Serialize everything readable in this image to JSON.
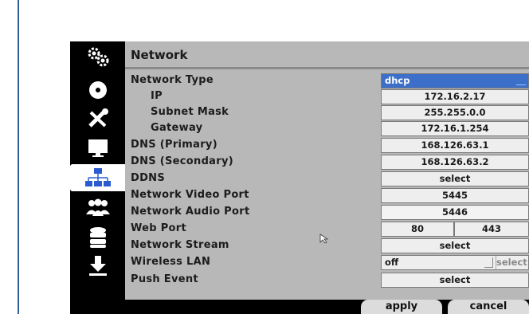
{
  "panel": {
    "title": "Network"
  },
  "rows": [
    {
      "label": "Network Type",
      "value": "dhcp"
    },
    {
      "label": "IP",
      "value": "172.16.2.17"
    },
    {
      "label": "Subnet Mask",
      "value": "255.255.0.0"
    },
    {
      "label": "Gateway",
      "value": "172.16.1.254"
    },
    {
      "label": "DNS (Primary)",
      "value": "168.126.63.1"
    },
    {
      "label": "DNS (Secondary)",
      "value": "168.126.63.2"
    },
    {
      "label": "DDNS",
      "value": "select"
    },
    {
      "label": "Network Video Port",
      "value": "5445"
    },
    {
      "label": "Network Audio Port",
      "value": "5446"
    },
    {
      "label": "Web Port",
      "value_http": "80",
      "value_https": "443"
    },
    {
      "label": "Network Stream",
      "value": "select"
    },
    {
      "label": "Wireless LAN",
      "value": "off",
      "select": "select"
    },
    {
      "label": "Push Event",
      "value": "select"
    }
  ],
  "buttons": {
    "apply": "apply",
    "cancel": "cancel"
  },
  "sidebar": [
    "gears-icon",
    "disc-icon",
    "tools-icon",
    "monitor-icon",
    "network-icon",
    "users-icon",
    "database-icon",
    "download-icon"
  ],
  "colors": {
    "accent": "#3b6fc9",
    "panel": "#b8b8b8",
    "frame": "#2f5f99"
  }
}
